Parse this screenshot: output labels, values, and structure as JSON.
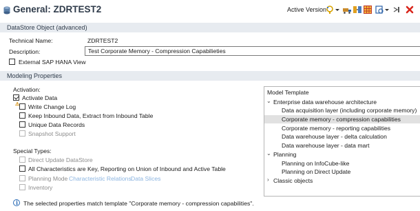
{
  "header": {
    "title": "General: ZDRTEST2",
    "version_label": "Active Version",
    "toolbar_icons": [
      "activate-icon",
      "dropdown-arrow-icon",
      "transport-icon",
      "mapping-icon",
      "grid-icon",
      "data-preview-icon",
      "dropdown-arrow-icon",
      "more-icon",
      "close-red-icon"
    ]
  },
  "datastore_section": {
    "title": "DataStore Object (advanced)",
    "technical_name_label": "Technical Name:",
    "technical_name_value": "ZDRTEST2",
    "description_label": "Description:",
    "description_value": "Test Corporate Memory - Compression Capabilieties",
    "external_view_label": "External SAP HANA View"
  },
  "modeling_section": {
    "title": "Modeling Properties",
    "activation_label": "Activation:",
    "activate_data_label": "Activate Data",
    "write_change_log_label": "Write Change Log",
    "keep_inbound_label": "Keep Inbound Data, Extract from Inbound Table",
    "unique_records_label": "Unique Data Records",
    "snapshot_label": "Snapshot Support",
    "special_types_label": "Special Types:",
    "direct_update_label": "Direct Update DataStore",
    "all_chars_label": "All Characteristics are Key, Reporting on Union of Inbound and Active Table",
    "planning_mode_label": "Planning Mode",
    "char_relations_link": "Characteristic Relations",
    "data_slices_link": "Data Slices",
    "inventory_label": "Inventory",
    "info_message": "The selected properties match template \"Corporate memory - compression capabilities\"."
  },
  "template_tree": {
    "title": "Model Template",
    "groups": [
      {
        "label": "Enterprise data warehouse architecture",
        "expanded": true,
        "children": [
          "Data acquisition layer (including corporate memory)",
          "Corporate memory - compression capabilities",
          "Corporate memory - reporting capabilities",
          "Data warehouse layer - delta calculation",
          "Data warehouse layer - data mart"
        ]
      },
      {
        "label": "Planning",
        "expanded": true,
        "children": [
          "Planning on InfoCube-like",
          "Planning on Direct Update"
        ]
      },
      {
        "label": "Classic objects",
        "expanded": false,
        "children": []
      }
    ],
    "selected": "Corporate memory - compression capabilities"
  },
  "colors": {
    "section_header_bg": "#e7ebf0",
    "selection_bg": "#e1e1e1",
    "link": "#8bb4e0",
    "close": "#d9261c"
  }
}
